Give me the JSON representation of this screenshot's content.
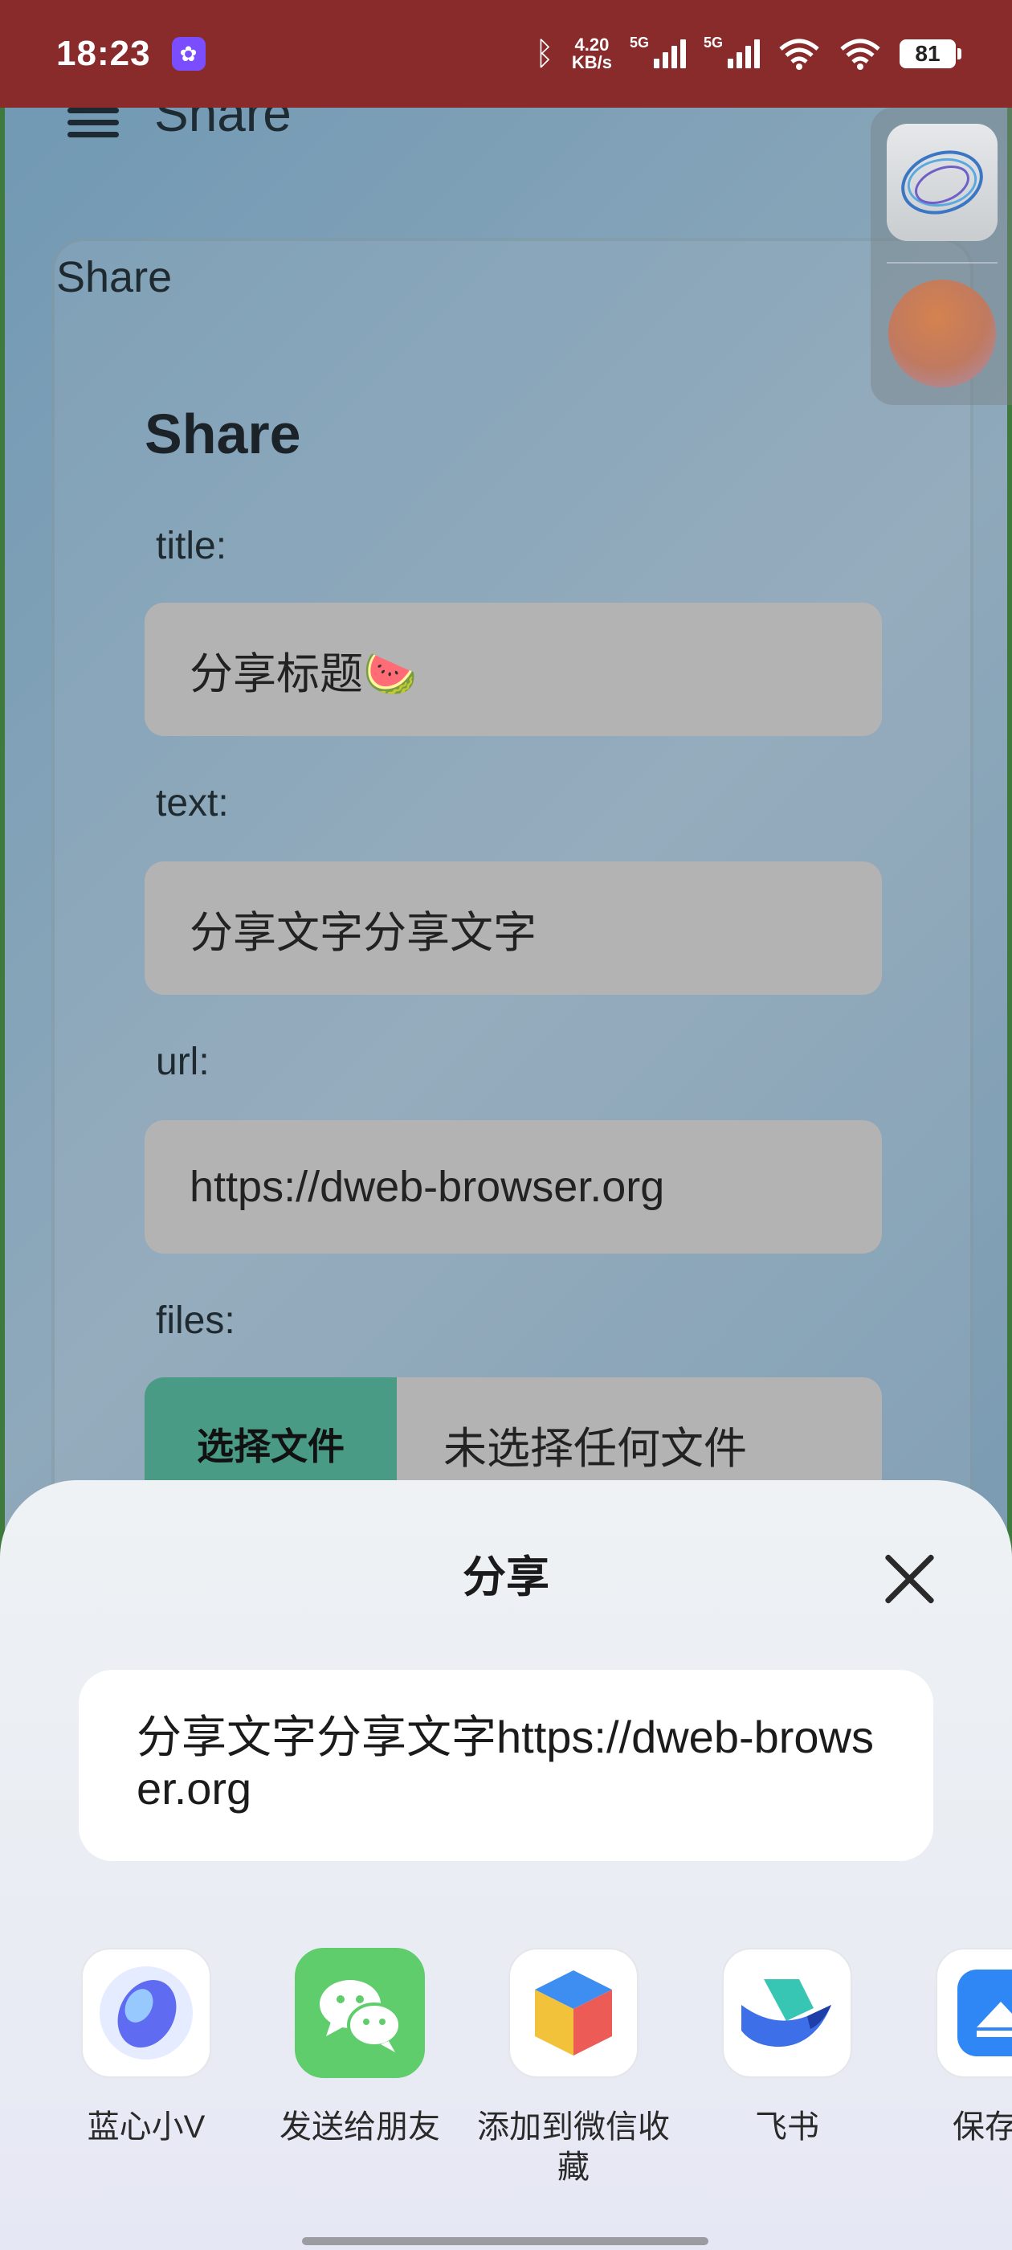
{
  "status_bar": {
    "time": "18:23",
    "net_speed_value": "4.20",
    "net_speed_unit": "KB/s",
    "sim1_tag": "5G",
    "sim2_tag": "5G",
    "battery": "81"
  },
  "app": {
    "header_title": "Share",
    "card_label": "Share",
    "form": {
      "heading": "Share",
      "title_label": "title:",
      "title_value": "分享标题🍉",
      "text_label": "text:",
      "text_value": "分享文字分享文字",
      "url_label": "url:",
      "url_value": "https://dweb-browser.org",
      "files_label": "files:",
      "choose_file_button": "选择文件",
      "no_file_text": "未选择任何文件"
    }
  },
  "share_sheet": {
    "title": "分享",
    "preview_text": "分享文字分享文字https://dweb-browser.org",
    "targets": [
      {
        "label": "蓝心小V",
        "icon": "lanxin-icon"
      },
      {
        "label": "发送给朋友",
        "icon": "wechat-icon"
      },
      {
        "label": "添加到微信收藏",
        "icon": "wechat-favorites-icon"
      },
      {
        "label": "飞书",
        "icon": "feishu-icon"
      },
      {
        "label": "保存为",
        "icon": "save-as-icon"
      }
    ]
  },
  "colors": {
    "status_bar": "#8a2b2b",
    "file_button": "#4a9b85",
    "input_bg": "#b3b3b3"
  }
}
